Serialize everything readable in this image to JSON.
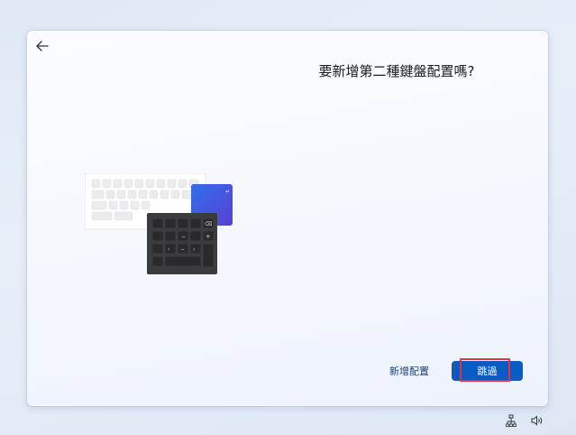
{
  "page": {
    "title": "要新增第二種鍵盤配置嗎?"
  },
  "buttons": {
    "add_layout_label": "新增配置",
    "skip_label": "跳過"
  },
  "keyboard_illustration": {
    "backspace_glyph": "⌫",
    "minus_glyph": "−",
    "plus_glyph": "+",
    "enter_glyph": "↵"
  },
  "tray": {
    "icons": [
      "network-icon",
      "volume-icon"
    ]
  },
  "colors": {
    "accent": "#0a5cc4",
    "highlight": "#e0343e"
  }
}
